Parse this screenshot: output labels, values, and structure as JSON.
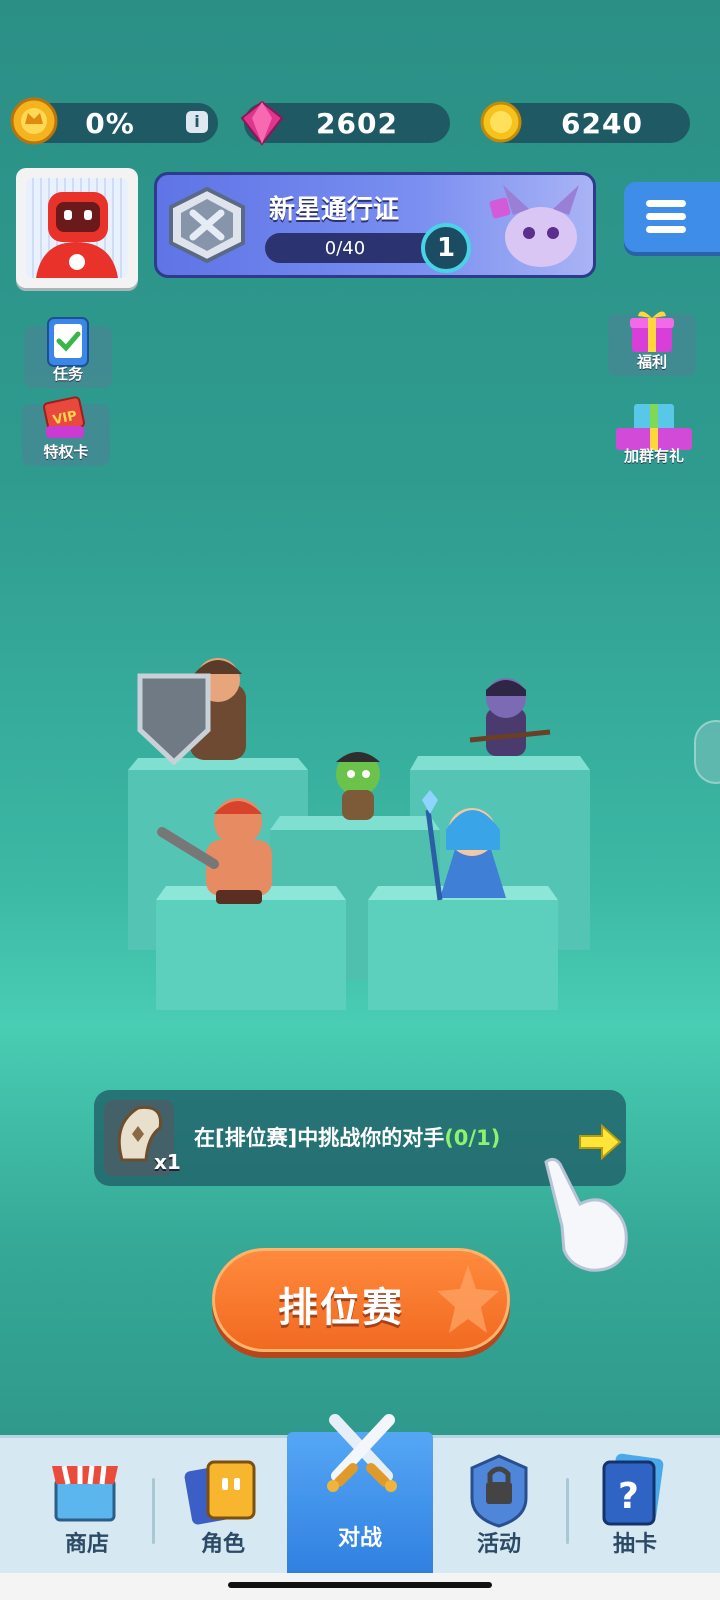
{
  "currencies": [
    {
      "id": "rank",
      "value": "0%",
      "icon": "crown-badge-icon"
    },
    {
      "id": "gems",
      "value": "2602",
      "icon": "pink-gem-icon"
    },
    {
      "id": "coins",
      "value": "6240",
      "icon": "gold-coin-icon"
    }
  ],
  "pass": {
    "title": "新星通行证",
    "progress": "0/40",
    "progress_fraction": 0.0,
    "level": "1"
  },
  "side_left": [
    {
      "label": "任务",
      "icon": "clipboard-check-icon"
    },
    {
      "label": "特权卡",
      "icon": "vip-card-icon"
    }
  ],
  "side_right": [
    {
      "label": "福利",
      "icon": "gift-box-icon"
    },
    {
      "label": "加群有礼",
      "icon": "gift-stack-icon"
    }
  ],
  "quest": {
    "text": "在[排位赛]中挑战你的对手",
    "progress": "(0/1)",
    "reward_count": "x1"
  },
  "ranked_button": "排位赛",
  "nav": [
    {
      "label": "商店",
      "icon": "shop-icon"
    },
    {
      "label": "角色",
      "icon": "character-cards-icon"
    },
    {
      "label": "对战",
      "icon": "crossed-swords-icon",
      "active": true
    },
    {
      "label": "活动",
      "icon": "lock-icon"
    },
    {
      "label": "抽卡",
      "icon": "mystery-card-icon"
    }
  ],
  "colors": {
    "accent": "#f16a21",
    "active_tab": "#2f7fe0",
    "gem": "#e0358f",
    "coin": "#f6c21c"
  }
}
